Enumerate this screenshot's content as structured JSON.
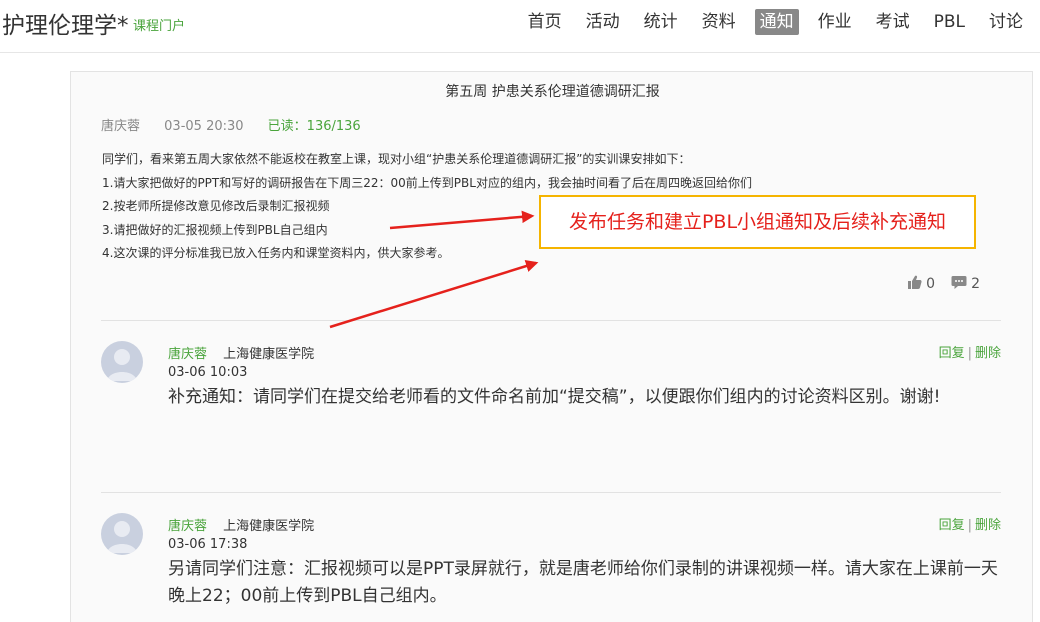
{
  "header": {
    "title": "护理伦理学*",
    "subtitle": "课程门户",
    "nav": [
      {
        "label": "首页",
        "active": false
      },
      {
        "label": "活动",
        "active": false
      },
      {
        "label": "统计",
        "active": false
      },
      {
        "label": "资料",
        "active": false
      },
      {
        "label": "通知",
        "active": true
      },
      {
        "label": "作业",
        "active": false
      },
      {
        "label": "考试",
        "active": false
      },
      {
        "label": "PBL",
        "active": false
      },
      {
        "label": "讨论",
        "active": false
      }
    ]
  },
  "post": {
    "title": "第五周 护患关系伦理道德调研汇报",
    "author": "唐庆蓉",
    "time": "03-05 20:30",
    "read": "已读：136/136",
    "lines": [
      "同学们，看来第五周大家依然不能返校在教室上课，现对小组“护患关系伦理道德调研汇报”的实训课安排如下：",
      "1.请大家把做好的PPT和写好的调研报告在下周三22：00前上传到PBL对应的组内，我会抽时间看了后在周四晚返回给你们",
      "2.按老师所提修改意见修改后录制汇报视频",
      "3.请把做好的汇报视频上传到PBL自己组内",
      "4.这次课的评分标准我已放入任务内和课堂资料内，供大家参考。"
    ],
    "likes": "0",
    "comments": "2"
  },
  "annotation": {
    "text": "发布任务和建立PBL小组通知及后续补充通知",
    "border_color": "#f5b400",
    "text_color": "#e5211c"
  },
  "replies": [
    {
      "author": "唐庆蓉",
      "school": "上海健康医学院",
      "time": "03-06 10:03",
      "body": "补充通知：请同学们在提交给老师看的文件命名前加“提交稿”，以便跟你们组内的讨论资料区别。谢谢!",
      "reply_label": "回复",
      "delete_label": "删除"
    },
    {
      "author": "唐庆蓉",
      "school": "上海健康医学院",
      "time": "03-06 17:38",
      "body": "另请同学们注意：汇报视频可以是PPT录屏就行，就是唐老师给你们录制的讲课视频一样。请大家在上课前一天晚上22；00前上传到PBL自己组内。",
      "reply_label": "回复",
      "delete_label": "删除"
    }
  ],
  "colors": {
    "accent_green": "#4aa43c",
    "nav_active_bg": "#888888",
    "arrow_red": "#e5211c"
  }
}
